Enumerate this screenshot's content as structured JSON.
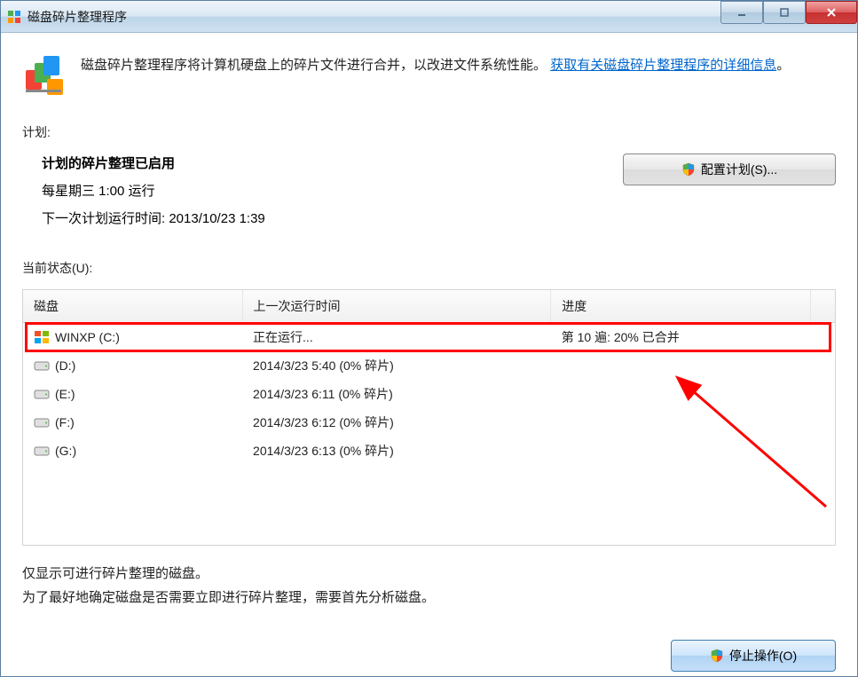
{
  "titlebar": {
    "title": "磁盘碎片整理程序"
  },
  "header": {
    "description_prefix": "磁盘碎片整理程序将计算机硬盘上的碎片文件进行合并，以改进文件系统性能。",
    "link_text": "获取有关磁盘碎片整理程序的详细信息",
    "link_suffix": "。"
  },
  "schedule": {
    "label": "计划:",
    "enabled_title": "计划的碎片整理已启用",
    "run_time": "每星期三   1:00 运行",
    "next_run": "下一次计划运行时间: 2013/10/23 1:39",
    "config_button": "配置计划(S)..."
  },
  "status": {
    "label": "当前状态(U):",
    "columns": {
      "disk": "磁盘",
      "last_run": "上一次运行时间",
      "progress": "进度"
    },
    "rows": [
      {
        "name": "WINXP (C:)",
        "last_run": "正在运行...",
        "progress": "第 10 遍: 20% 已合并",
        "icon": "windows",
        "highlight": true
      },
      {
        "name": "(D:)",
        "last_run": "2014/3/23 5:40 (0% 碎片)",
        "progress": "",
        "icon": "drive"
      },
      {
        "name": "(E:)",
        "last_run": "2014/3/23 6:11 (0% 碎片)",
        "progress": "",
        "icon": "drive"
      },
      {
        "name": "(F:)",
        "last_run": "2014/3/23 6:12 (0% 碎片)",
        "progress": "",
        "icon": "drive"
      },
      {
        "name": "(G:)",
        "last_run": "2014/3/23 6:13 (0% 碎片)",
        "progress": "",
        "icon": "drive"
      }
    ]
  },
  "footer": {
    "line1": "仅显示可进行碎片整理的磁盘。",
    "line2": "为了最好地确定磁盘是否需要立即进行碎片整理，需要首先分析磁盘。"
  },
  "buttons": {
    "stop": "停止操作(O)"
  }
}
